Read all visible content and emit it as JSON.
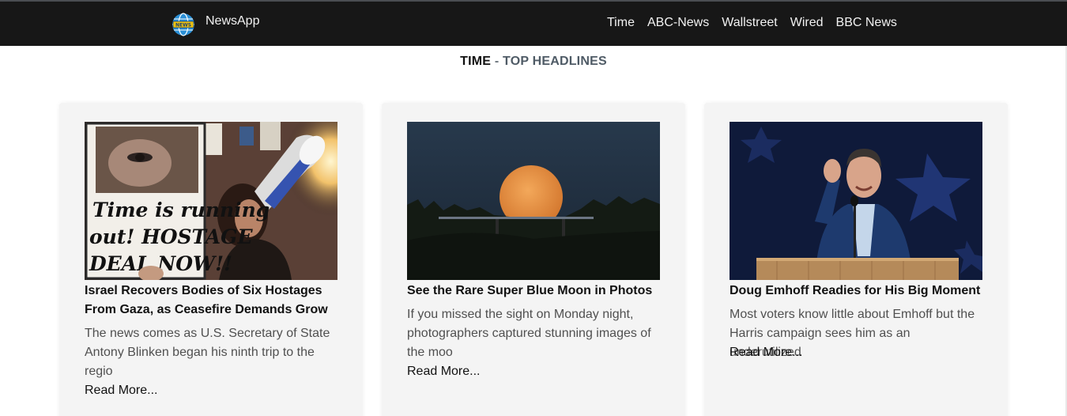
{
  "navbar": {
    "brand_name": "NewsApp",
    "logo_text": "NEWS",
    "links": [
      "Time",
      "ABC-News",
      "Wallstreet",
      "Wired",
      "BBC News"
    ]
  },
  "heading": {
    "source": "TIME",
    "separator": " - ",
    "rest": "TOP HEADLINES"
  },
  "articles": [
    {
      "title": "Israel Recovers Bodies of Six Hostages From Gaza, as Ceasefire Demands Grow",
      "description": "The news comes as U.S. Secretary of State Antony Blinken began his ninth trip to the regio",
      "read_more": "Read More...",
      "image_sign_lines": [
        "Time is running",
        "out! HOSTAGE",
        "DEAL NOW!!"
      ]
    },
    {
      "title": "See the Rare Super Blue Moon in Photos",
      "description": "If you missed the sight on Monday night, photographers captured stunning images of the moo",
      "read_more": "Read More..."
    },
    {
      "title": "Doug Emhoff Readies for His Big Moment",
      "description": "Most voters know little about Emhoff but the Harris campaign sees him as an underutilized",
      "read_more": "Read More..."
    }
  ],
  "colors": {
    "navbar_bg": "#171717",
    "card_bg": "#f4f4f4",
    "heading_accent": "#4f5b66",
    "description_text": "#505050"
  }
}
